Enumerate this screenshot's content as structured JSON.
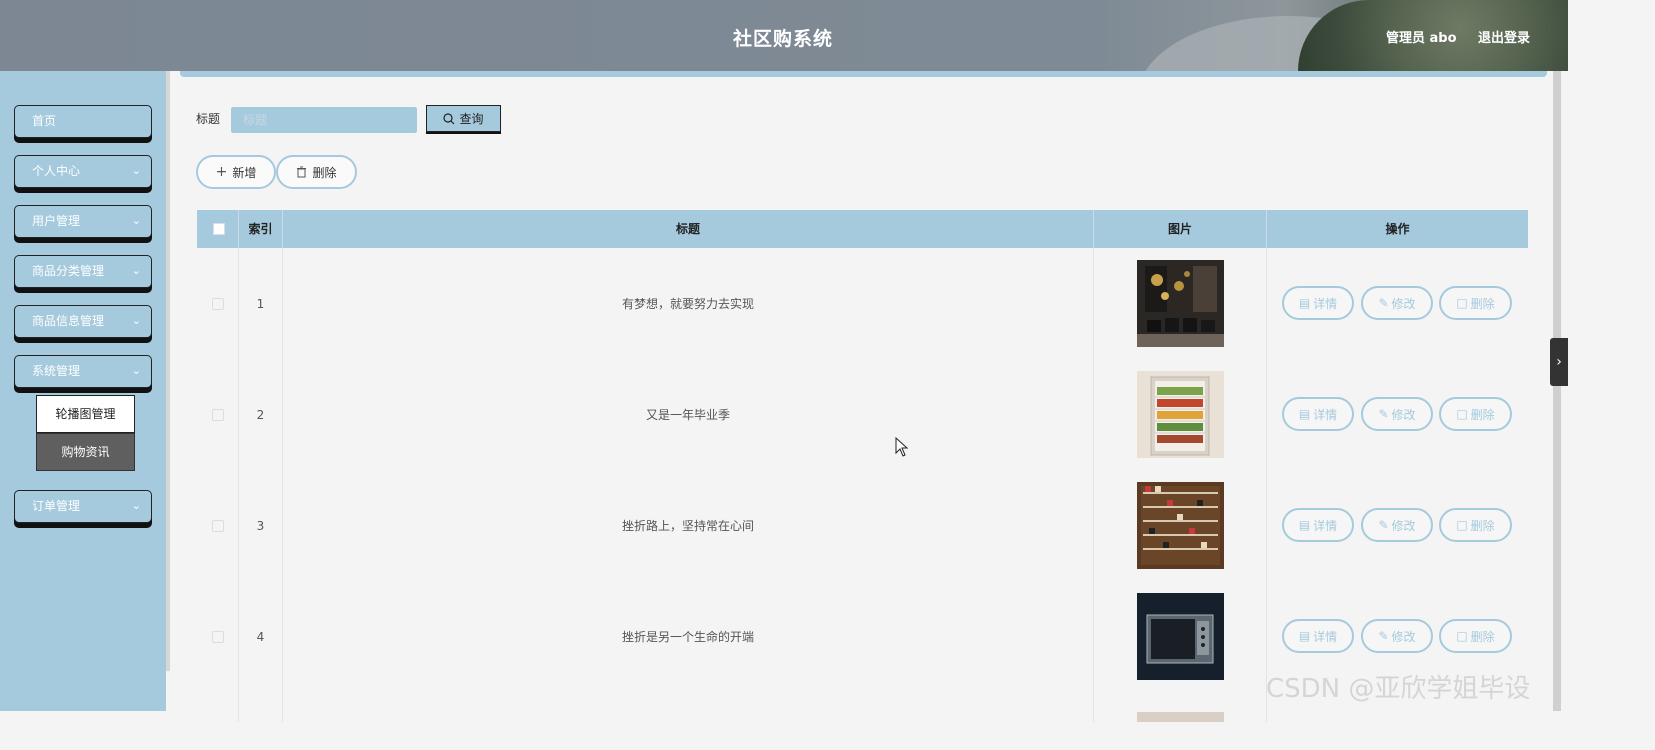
{
  "header": {
    "title": "社区购系统",
    "user": "管理员 abo",
    "logout": "退出登录"
  },
  "sidebar": {
    "items": [
      {
        "label": "首页",
        "chevron": false
      },
      {
        "label": "个人中心",
        "chevron": true
      },
      {
        "label": "用户管理",
        "chevron": true
      },
      {
        "label": "商品分类管理",
        "chevron": true
      },
      {
        "label": "商品信息管理",
        "chevron": true
      },
      {
        "label": "系统管理",
        "chevron": true
      },
      {
        "label": "订单管理",
        "chevron": true
      }
    ],
    "submenu": [
      {
        "label": "轮播图管理"
      },
      {
        "label": "购物资讯"
      }
    ]
  },
  "search": {
    "label": "标题",
    "placeholder": "标题",
    "query_label": "查询"
  },
  "toolbar": {
    "add_label": "新增",
    "delete_label": "删除"
  },
  "table": {
    "headers": {
      "index": "索引",
      "title": "标题",
      "image": "图片",
      "actions": "操作"
    },
    "rows": [
      {
        "index": "1",
        "title": "有梦想，就要努力去实现",
        "image": "black-cabinet"
      },
      {
        "index": "2",
        "title": "又是一年毕业季",
        "image": "refrigerator"
      },
      {
        "index": "3",
        "title": "挫折路上，坚持常在心间",
        "image": "shoe-rack"
      },
      {
        "index": "4",
        "title": "挫折是另一个生命的开端",
        "image": "microwave"
      }
    ],
    "actions": {
      "detail": "详情",
      "edit": "修改",
      "remove": "删除"
    }
  },
  "watermark": "CSDN @亚欣学姐毕设",
  "colors": {
    "accent": "#a5cadd",
    "header": "#7c8793",
    "sidebar": "#a5cadd"
  }
}
